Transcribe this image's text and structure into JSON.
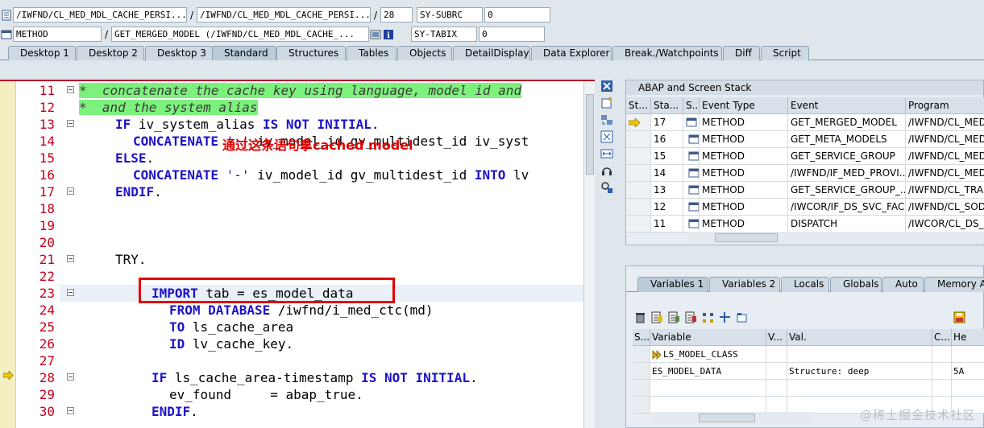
{
  "info": {
    "program1": "/IWFND/CL_MED_MDL_CACHE_PERSI...",
    "program2": "/IWFND/CL_MED_MDL_CACHE_PERSI...",
    "line": "28",
    "sy_subrc_label": "SY-SUBRC",
    "sy_subrc_value": "0",
    "event_type": "METHOD",
    "event": "GET_MERGED_MODEL (/IWFND/CL_MED_MDL_CACHE_...",
    "sy_tabix_label": "SY-TABIX",
    "sy_tabix_value": "0",
    "separator": "/"
  },
  "tabs": [
    {
      "label": "Desktop 1"
    },
    {
      "label": "Desktop 2"
    },
    {
      "label": "Desktop 3"
    },
    {
      "label": "Standard"
    },
    {
      "label": "Structures"
    },
    {
      "label": "Tables"
    },
    {
      "label": "Objects"
    },
    {
      "label": "DetailDisplay"
    },
    {
      "label": "Data Explorer"
    },
    {
      "label": "Break./Watchpoints"
    },
    {
      "label": "Diff"
    },
    {
      "label": "Script"
    }
  ],
  "code": {
    "annotation": "通过这条语句拿cached model",
    "lines": [
      {
        "no": "11"
      },
      {
        "no": "12"
      },
      {
        "no": "13"
      },
      {
        "no": "14"
      },
      {
        "no": "15"
      },
      {
        "no": "16"
      },
      {
        "no": "17"
      },
      {
        "no": "18"
      },
      {
        "no": "19"
      },
      {
        "no": "20"
      },
      {
        "no": "21"
      },
      {
        "no": "22"
      },
      {
        "no": "23"
      },
      {
        "no": "24"
      },
      {
        "no": "25"
      },
      {
        "no": "26"
      },
      {
        "no": "27"
      },
      {
        "no": "28"
      },
      {
        "no": "29"
      },
      {
        "no": "30"
      }
    ]
  },
  "stack": {
    "title": "ABAP and Screen Stack",
    "columns": [
      "St...",
      "Sta...",
      "S..",
      "Event Type",
      "Event",
      "Program"
    ],
    "rows": [
      {
        "level": "17",
        "type": "METHOD",
        "event": "GET_MERGED_MODEL",
        "program": "/IWFND/CL_MED_"
      },
      {
        "level": "16",
        "type": "METHOD",
        "event": "GET_META_MODELS",
        "program": "/IWFND/CL_MED_"
      },
      {
        "level": "15",
        "type": "METHOD",
        "event": "GET_SERVICE_GROUP",
        "program": "/IWFND/CL_MED_"
      },
      {
        "level": "14",
        "type": "METHOD",
        "event": "/IWFND/IF_MED_PROVI...",
        "program": "/IWFND/CL_MED_"
      },
      {
        "level": "13",
        "type": "METHOD",
        "event": "GET_SERVICE_GROUP_...",
        "program": "/IWFND/CL_TRAN"
      },
      {
        "level": "12",
        "type": "METHOD",
        "event": "/IWCOR/IF_DS_SVC_FAC...",
        "program": "/IWFND/CL_SODA"
      },
      {
        "level": "11",
        "type": "METHOD",
        "event": "DISPATCH",
        "program": "/IWCOR/CL_DS_H"
      }
    ]
  },
  "vars": {
    "tabs": [
      "Variables 1",
      "Variables 2",
      "Locals",
      "Globals",
      "Auto",
      "Memory An"
    ],
    "columns": [
      "S...",
      "Variable",
      "V...",
      "Val.",
      "C...",
      "He"
    ],
    "rows": [
      {
        "variable": "LS_MODEL_CLASS",
        "value": "",
        "c": ""
      },
      {
        "variable": "ES_MODEL_DATA",
        "value": "Structure: deep",
        "c": "5A"
      },
      {
        "variable": "",
        "value": "",
        "c": ""
      },
      {
        "variable": "",
        "value": "",
        "c": ""
      }
    ]
  },
  "watermark": "@稀土掘金技术社区"
}
